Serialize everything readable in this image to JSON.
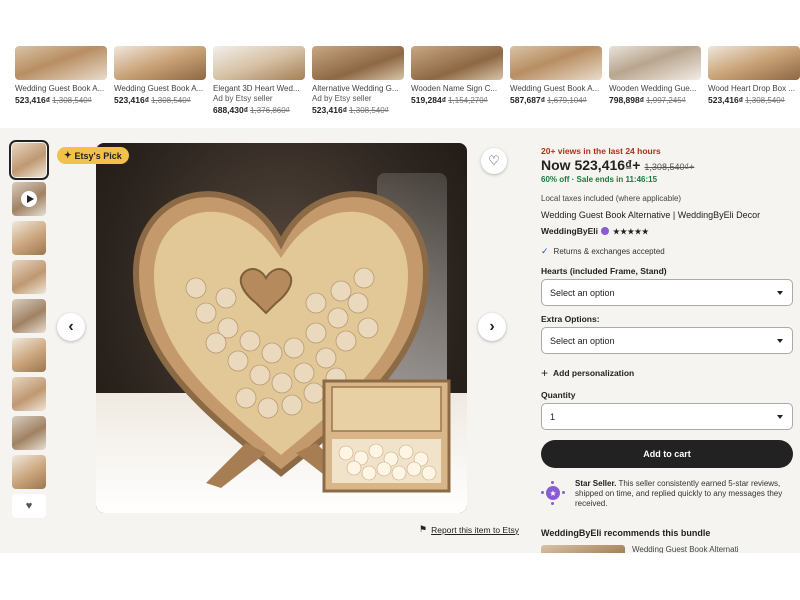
{
  "carousel": [
    {
      "title": "Wedding Guest Book A...",
      "ad": "",
      "price": "523,416₫",
      "was": "1,308,540₫"
    },
    {
      "title": "Wedding Guest Book A...",
      "ad": "",
      "price": "523,416₫",
      "was": "1,308,540₫"
    },
    {
      "title": "Elegant 3D Heart Wed...",
      "ad": "Ad by Etsy seller",
      "price": "688,430₫",
      "was": "1,376,860₫"
    },
    {
      "title": "Alternative Wedding G...",
      "ad": "Ad by Etsy seller",
      "price": "523,416₫",
      "was": "1,308,540₫"
    },
    {
      "title": "Wooden Name Sign C...",
      "ad": "",
      "price": "519,284₫",
      "was": "1,154,270₫"
    },
    {
      "title": "Wedding Guest Book A...",
      "ad": "",
      "price": "587,687₫",
      "was": "1,679,104₫"
    },
    {
      "title": "Wooden Wedding Gue...",
      "ad": "",
      "price": "798,898₫",
      "was": "1,997,245₫"
    },
    {
      "title": "Wood Heart Drop Box ...",
      "ad": "",
      "price": "523,416₫",
      "was": "1,308,540₫"
    }
  ],
  "gallery": {
    "badge": "Etsy's Pick",
    "favorite_icon": "heart-outline-icon",
    "prev_icon": "chevron-left-icon",
    "next_icon": "chevron-right-icon",
    "report_link": "Report this item to Etsy"
  },
  "listing": {
    "views": "20+ views in the last 24 hours",
    "price_now": "Now 523,416₫+",
    "price_was": "1,308,540₫+",
    "discount": "60% off · Sale ends in 11:46:15",
    "tax_note": "Local taxes included (where applicable)",
    "title": "Wedding Guest Book Alternative | WeddingByEli Decor",
    "seller": "WeddingByEli",
    "rating": 5,
    "stars": "★★★★★",
    "returns": "Returns & exchanges accepted",
    "hearts_label": "Hearts (included Frame, Stand)",
    "hearts_value": "Select an option",
    "extra_label": "Extra Options:",
    "extra_value": "Select an option",
    "personalization": "Add personalization",
    "quantity_label": "Quantity",
    "quantity_value": "1",
    "add_to_cart": "Add to cart",
    "star_seller_bold": "Star Seller.",
    "star_seller_text": " This seller consistently earned 5-star reviews, shipped on time, and replied quickly to any messages they received.",
    "recommends": "WeddingByEli recommends this bundle",
    "bundle_title": "Wedding Guest Book Alternati"
  },
  "colors": {
    "views_red": "#b12e1a",
    "discount_green": "#1b7a3c",
    "badge_yellow": "#f1c14b",
    "star_seller_purple": "#8a5cd4",
    "cart_black": "#222222"
  }
}
